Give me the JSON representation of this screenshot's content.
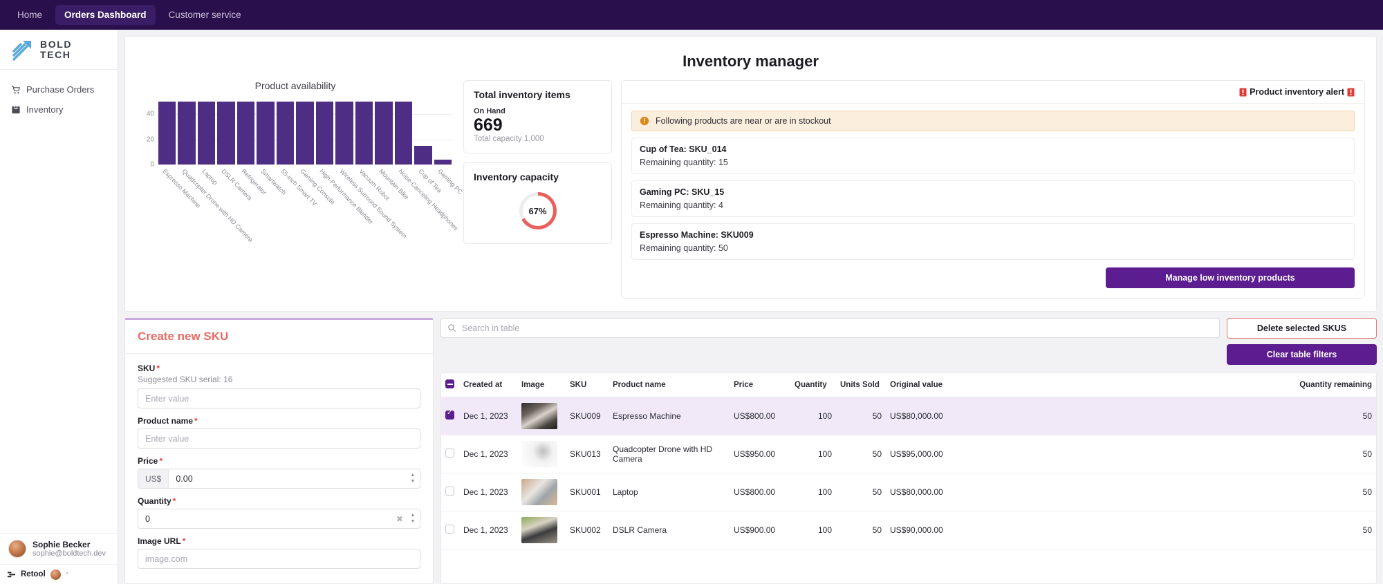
{
  "topnav": {
    "items": [
      {
        "label": "Home",
        "active": false
      },
      {
        "label": "Orders Dashboard",
        "active": true
      },
      {
        "label": "Customer service",
        "active": false
      }
    ]
  },
  "sidebar": {
    "logo": {
      "line1": "BOLD",
      "line2": "TECH"
    },
    "items": [
      {
        "label": "Purchase Orders",
        "icon": "cart-icon"
      },
      {
        "label": "Inventory",
        "icon": "box-icon"
      }
    ],
    "user": {
      "name": "Sophie Becker",
      "email": "sophie@boldtech.dev"
    },
    "footer": {
      "brand": "Retool"
    }
  },
  "header": {
    "title": "Inventory manager"
  },
  "chart_data": {
    "type": "bar",
    "title": "Product availability",
    "xlabel": "",
    "ylabel": "",
    "ylim": [
      0,
      55
    ],
    "yticks": [
      0,
      20,
      40
    ],
    "grid": true,
    "legend": false,
    "bar_color": "#4d2e84",
    "categories": [
      "Espresso Machine",
      "Quadcopter Drone with HD Camera",
      "Laptop",
      "DSLR Camera",
      "Refrigerator",
      "Smartwatch",
      "55-inch Smart TV",
      "Gaming Console",
      "High-Performance Blender",
      "Wireless Surround Sound System",
      "Vacuum Robot",
      "Mountain Bike",
      "Noise-Canceling Headphones",
      "Cup of Tea",
      "Gaming PC"
    ],
    "values": [
      50,
      50,
      50,
      50,
      50,
      50,
      50,
      50,
      50,
      50,
      50,
      50,
      50,
      15,
      4
    ]
  },
  "kpi": {
    "total": {
      "title": "Total inventory items",
      "sub": "On Hand",
      "value": "669",
      "footer": "Total capacity 1,000"
    },
    "capacity": {
      "title": "Inventory capacity",
      "percent": "67%",
      "percent_value": 67,
      "ring_color": "#e8605e",
      "track_color": "#ececed"
    }
  },
  "alerts": {
    "header": "Product inventory alert",
    "header_icon_left": "red-alert-icon",
    "header_icon_right": "red-alert-icon",
    "banner": {
      "icon": "warning-icon",
      "text": "Following products are near or are in stockout"
    },
    "items": [
      {
        "name": "Cup of Tea: SKU_014",
        "qty": "Remaining quantity: 15"
      },
      {
        "name": "Gaming PC: SKU_15",
        "qty": "Remaining quantity: 4"
      },
      {
        "name": "Espresso Machine: SKU009",
        "qty": "Remaining quantity: 50"
      }
    ],
    "manage_button": "Manage low inventory products"
  },
  "form": {
    "title": "Create new SKU",
    "fields": [
      {
        "label": "SKU",
        "required": true,
        "hint": "Suggested SKU serial: 16",
        "placeholder": "Enter value",
        "value": "",
        "type": "text"
      },
      {
        "label": "Product name",
        "required": true,
        "hint": "",
        "placeholder": "Enter value",
        "value": "",
        "type": "text"
      },
      {
        "label": "Price",
        "required": true,
        "prefix": "US$",
        "value": "0.00",
        "type": "stepper"
      },
      {
        "label": "Quantity",
        "required": true,
        "value": "0",
        "type": "stepper-clear"
      },
      {
        "label": "Image URL",
        "required": true,
        "placeholder": "image.com",
        "value": "",
        "type": "text"
      }
    ]
  },
  "table": {
    "search_placeholder": "Search in table",
    "search_value": "",
    "delete_button": "Delete selected SKUS",
    "clear_button": "Clear table filters",
    "columns": [
      "Created at",
      "Image",
      "SKU",
      "Product name",
      "Price",
      "Quantity",
      "Units Sold",
      "Original value",
      "Quantity remaining"
    ],
    "rows": [
      {
        "selected": true,
        "created_at": "Dec 1, 2023",
        "image": "espresso-machine-photo",
        "sku": "SKU009",
        "product_name": "Espresso Machine",
        "price": "US$800.00",
        "quantity": "100",
        "units_sold": "50",
        "original_value": "US$80,000.00",
        "quantity_remaining": "50"
      },
      {
        "selected": false,
        "created_at": "Dec 1, 2023",
        "image": "drone-photo",
        "sku": "SKU013",
        "product_name": "Quadcopter Drone with HD Camera",
        "price": "US$950.00",
        "quantity": "100",
        "units_sold": "50",
        "original_value": "US$95,000.00",
        "quantity_remaining": "50"
      },
      {
        "selected": false,
        "created_at": "Dec 1, 2023",
        "image": "laptop-photo",
        "sku": "SKU001",
        "product_name": "Laptop",
        "price": "US$800.00",
        "quantity": "100",
        "units_sold": "50",
        "original_value": "US$80,000.00",
        "quantity_remaining": "50"
      },
      {
        "selected": false,
        "created_at": "Dec 1, 2023",
        "image": "dslr-camera-photo",
        "sku": "SKU002",
        "product_name": "DSLR Camera",
        "price": "US$900.00",
        "quantity": "100",
        "units_sold": "50",
        "original_value": "US$90,000.00",
        "quantity_remaining": "50"
      }
    ]
  }
}
